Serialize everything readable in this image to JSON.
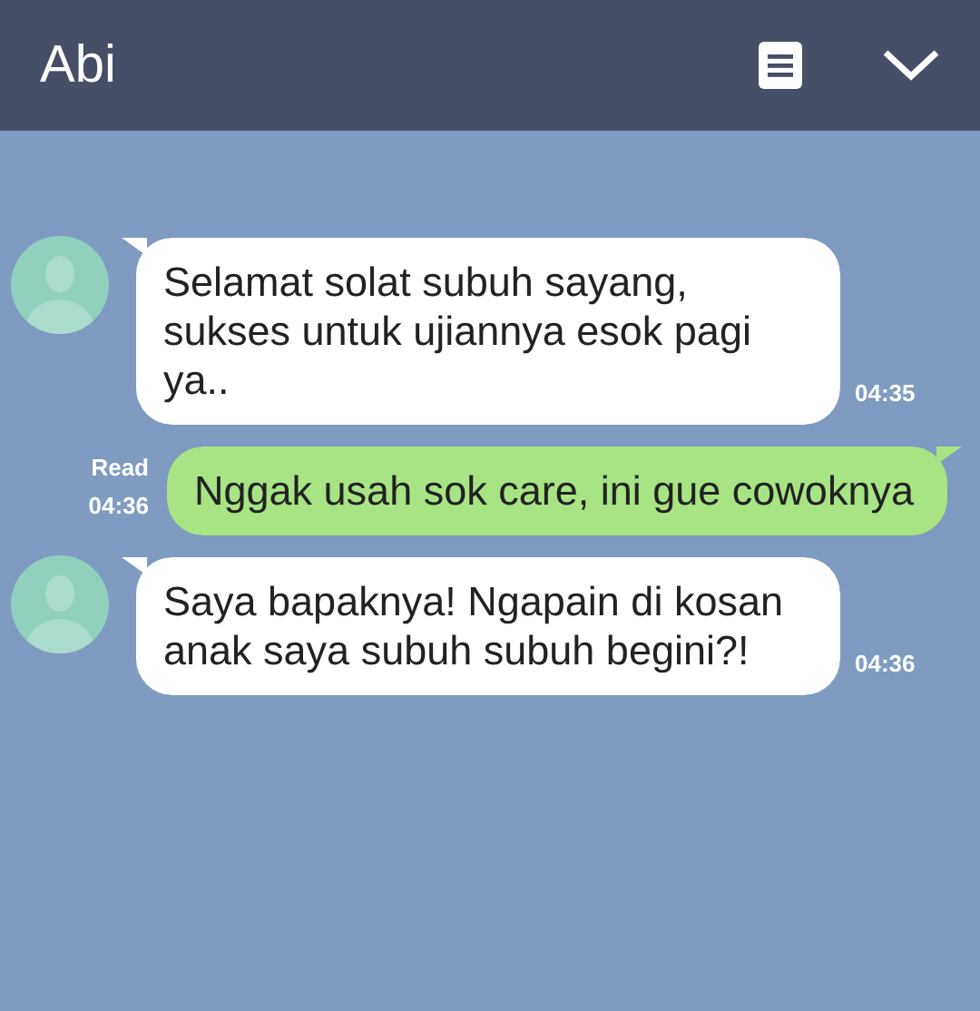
{
  "header": {
    "title": "Abi"
  },
  "messages": [
    {
      "kind": "received",
      "text": "Selamat solat subuh sayang, sukses untuk ujiannya esok pagi ya..",
      "time": "04:35"
    },
    {
      "kind": "sent",
      "text": "Nggak usah sok care, ini gue cowoknya",
      "read": "Read",
      "time": "04:36"
    },
    {
      "kind": "received",
      "text": "Saya bapaknya! Ngapain di kosan anak saya subuh subuh begini?!",
      "time": "04:36"
    }
  ]
}
